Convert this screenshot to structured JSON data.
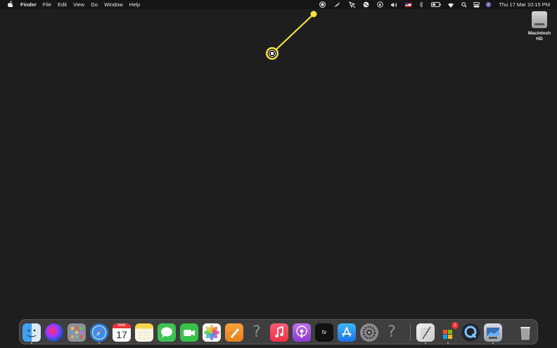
{
  "menubar": {
    "apple": "",
    "app_name": "Finder",
    "menus": [
      "File",
      "Edit",
      "View",
      "Go",
      "Window",
      "Help"
    ],
    "status_icons": [
      "screen-record-icon",
      "feather-icon",
      "cursor-icon",
      "globe-icon",
      "activity-icon",
      "volume-icon",
      "flag-us-icon",
      "bluetooth-icon",
      "battery-icon",
      "wifi-icon",
      "spotlight-search-icon",
      "control-center-icon",
      "siri-icon"
    ],
    "clock": "Thu 17 Mar  10:15 PM"
  },
  "desktop": {
    "drive_label_line1": "Macintosh",
    "drive_label_line2": "HD",
    "highlight_color": "#f4e13c"
  },
  "dock": {
    "calendar_month": "MAR",
    "calendar_day": "17",
    "appletv_label": "tv",
    "badge_count": "1",
    "apps": [
      "Finder",
      "Siri",
      "Launchpad",
      "Safari",
      "Calendar",
      "Notes",
      "Messages",
      "FaceTime",
      "Photos",
      "Pages",
      "Unknown",
      "Music",
      "Podcasts",
      "Apple TV",
      "App Store",
      "System Preferences",
      "Unknown",
      "TextEdit",
      "Microsoft Remote Desktop",
      "QuickTime Player",
      "Preview",
      "Trash"
    ]
  }
}
